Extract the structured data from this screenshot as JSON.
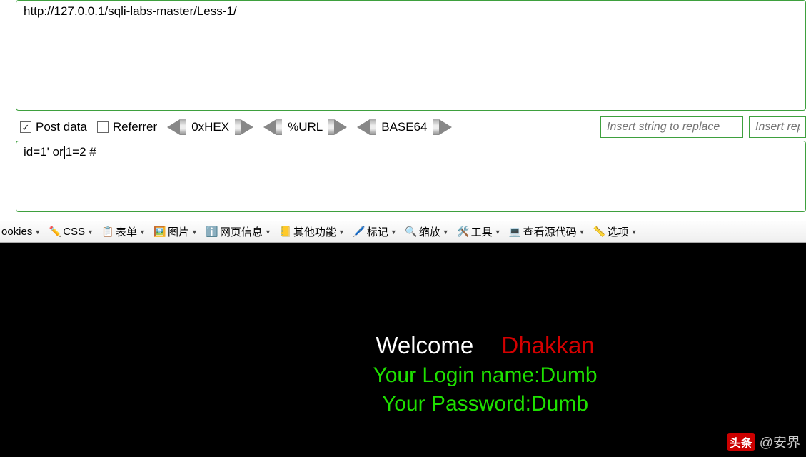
{
  "url_box": {
    "value": "http://127.0.0.1/sqli-labs-master/Less-1/"
  },
  "controls": {
    "post_data": {
      "label": "Post data",
      "checked": true
    },
    "referrer": {
      "label": "Referrer",
      "checked": false
    },
    "hex_button": "0xHEX",
    "url_button": "%URL",
    "base64_button": "BASE64",
    "insert_find_placeholder": "Insert string to replace",
    "insert_replace_placeholder": "Insert rep"
  },
  "post_box": {
    "value_before": "id=1' or",
    "value_after": "1=2 #"
  },
  "toolbar": {
    "cookies": "ookies",
    "css": "CSS",
    "forms": "表单",
    "images": "图片",
    "page_info": "网页信息",
    "other": "其他功能",
    "mark": "标记",
    "zoom": "缩放",
    "tools": "工具",
    "view_source": "查看源代码",
    "options": "选项"
  },
  "content": {
    "welcome": "Welcome",
    "name": "Dhakkan",
    "login_line": "Your Login name:Dumb",
    "password_line": "Your Password:Dumb"
  },
  "watermark": {
    "badge": "头条",
    "handle": "@安界"
  }
}
